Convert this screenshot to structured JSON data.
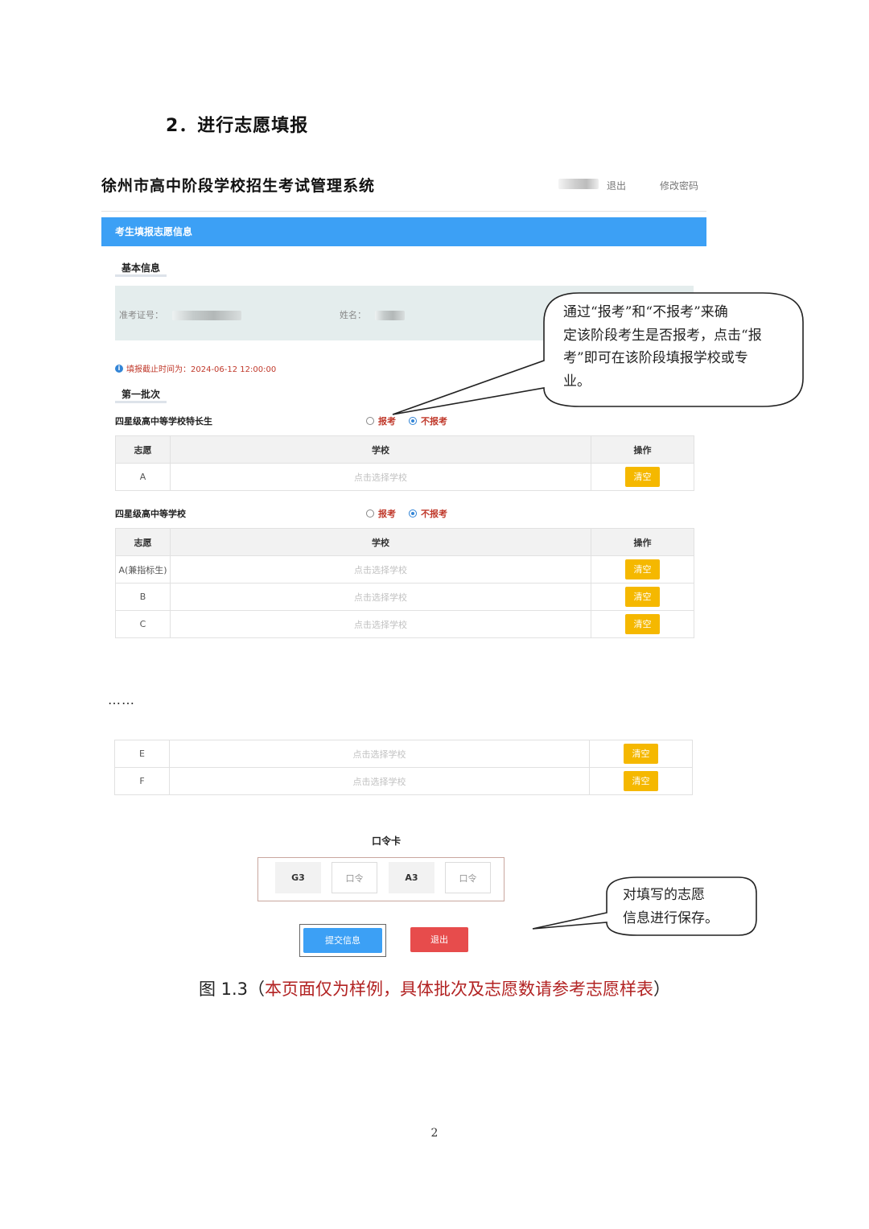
{
  "doc": {
    "heading": "2．进行志愿填报",
    "ellipsis": "……",
    "caption_prefix": "图 1.3（",
    "caption_red": "本页面仅为样例，具体批次及志愿数请参考志愿样表",
    "caption_suffix": "）",
    "page_number": "2"
  },
  "header": {
    "system_title": "徐州市高中阶段学校招生考试管理系统",
    "logout_label": "退出",
    "change_password_label": "修改密码"
  },
  "panel": {
    "title": "考生填报志愿信息"
  },
  "basic_info": {
    "section_title": "基本信息",
    "exam_id_label": "准考证号：",
    "name_label": "姓名："
  },
  "deadline": {
    "text": "填报截止时间为：2024-06-12 12:00:00"
  },
  "batch": {
    "title": "第一批次",
    "report_label": "报考",
    "not_report_label": "不报考",
    "groups": [
      {
        "label": "四星级高中等学校特长生",
        "selected": "不报考",
        "columns": [
          "志愿",
          "学校",
          "操作"
        ],
        "rows": [
          {
            "rank": "A",
            "school_placeholder": "点击选择学校",
            "action": "清空"
          }
        ]
      },
      {
        "label": "四星级高中等学校",
        "selected": "不报考",
        "columns": [
          "志愿",
          "学校",
          "操作"
        ],
        "rows": [
          {
            "rank": "A(兼指标生)",
            "school_placeholder": "点击选择学校",
            "action": "清空"
          },
          {
            "rank": "B",
            "school_placeholder": "点击选择学校",
            "action": "清空"
          },
          {
            "rank": "C",
            "school_placeholder": "点击选择学校",
            "action": "清空"
          }
        ]
      }
    ],
    "extra_rows": [
      {
        "rank": "E",
        "school_placeholder": "点击选择学校",
        "action": "清空"
      },
      {
        "rank": "F",
        "school_placeholder": "点击选择学校",
        "action": "清空"
      }
    ]
  },
  "token_card": {
    "title": "口令卡",
    "cells": [
      {
        "label": "G3",
        "placeholder": "口令"
      },
      {
        "label": "A3",
        "placeholder": "口令"
      }
    ]
  },
  "actions": {
    "submit_label": "提交信息",
    "exit_label": "退出"
  },
  "callouts": {
    "report": {
      "lines": [
        "通过“报考”和“不报考”来确",
        "定该阶段考生是否报考，点击“报",
        "考”即可在该阶段填报学校或专",
        "业。"
      ]
    },
    "save": {
      "lines": [
        "对填写的志愿",
        "信息进行保存。"
      ]
    }
  },
  "colors": {
    "panel_blue": "#3ca0f5",
    "clear_button": "#f5b800",
    "exit_button": "#e74c4c",
    "caption_red": "#b22222",
    "deadline_red": "#c0392b"
  }
}
